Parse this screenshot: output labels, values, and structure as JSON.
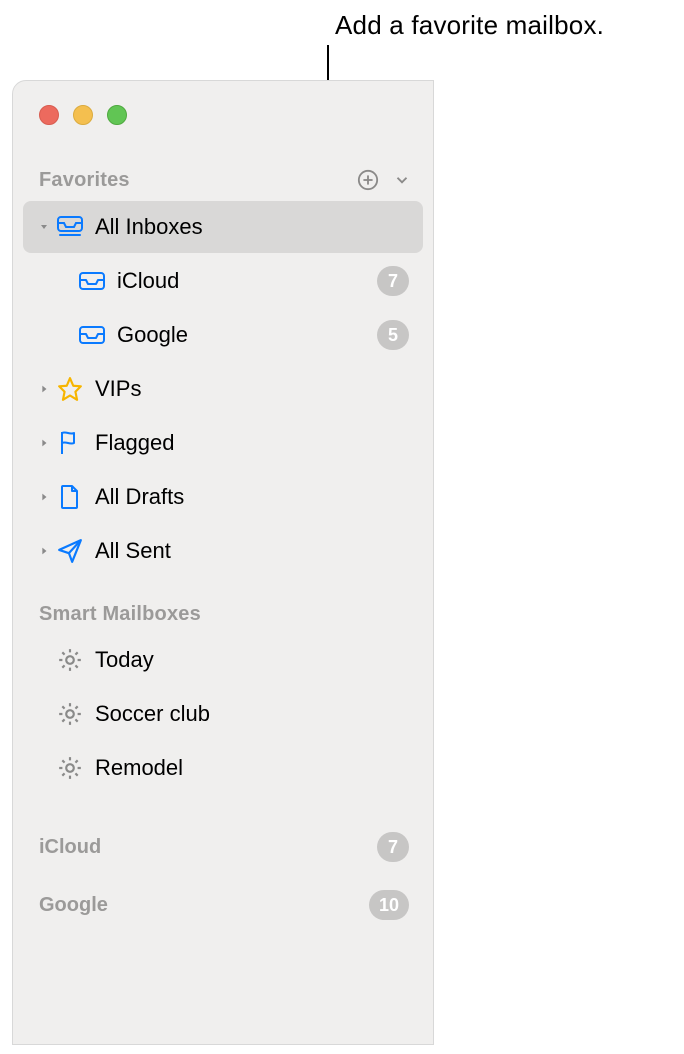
{
  "callout": "Add a favorite mailbox.",
  "sections": {
    "favorites": {
      "title": "Favorites",
      "items": [
        {
          "label": "All Inboxes",
          "icon": "stacked-inbox-icon",
          "selected": true,
          "expanded": true
        },
        {
          "label": "iCloud",
          "icon": "inbox-icon",
          "badge": "7",
          "child": true
        },
        {
          "label": "Google",
          "icon": "inbox-icon",
          "badge": "5",
          "child": true
        },
        {
          "label": "VIPs",
          "icon": "star-icon",
          "expandable": true
        },
        {
          "label": "Flagged",
          "icon": "flag-icon",
          "expandable": true
        },
        {
          "label": "All Drafts",
          "icon": "document-icon",
          "expandable": true
        },
        {
          "label": "All Sent",
          "icon": "paperplane-icon",
          "expandable": true
        }
      ]
    },
    "smart": {
      "title": "Smart Mailboxes",
      "items": [
        {
          "label": "Today",
          "icon": "gear-icon"
        },
        {
          "label": "Soccer club",
          "icon": "gear-icon"
        },
        {
          "label": "Remodel",
          "icon": "gear-icon"
        }
      ]
    },
    "accounts": [
      {
        "label": "iCloud",
        "badge": "7"
      },
      {
        "label": "Google",
        "badge": "10"
      }
    ]
  }
}
